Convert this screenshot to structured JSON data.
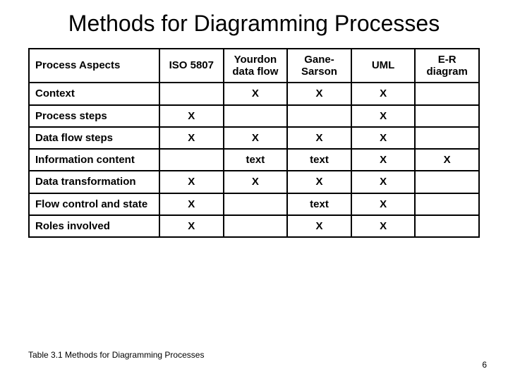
{
  "title": "Methods for Diagramming Processes",
  "table": {
    "corner": "Process Aspects",
    "cols": [
      "ISO 5807",
      "Yourdon data flow",
      "Gane-Sarson",
      "UML",
      "E-R diagram"
    ],
    "rows": [
      {
        "label": "Context",
        "cells": [
          "",
          "X",
          "X",
          "X",
          ""
        ]
      },
      {
        "label": "Process steps",
        "cells": [
          "X",
          "",
          "",
          "X",
          ""
        ]
      },
      {
        "label": "Data flow steps",
        "cells": [
          "X",
          "X",
          "X",
          "X",
          ""
        ]
      },
      {
        "label": "Information content",
        "cells": [
          "",
          "text",
          "text",
          "X",
          "X"
        ]
      },
      {
        "label": "Data transformation",
        "cells": [
          "X",
          "X",
          "X",
          "X",
          ""
        ]
      },
      {
        "label": "Flow control and state",
        "cells": [
          "X",
          "",
          "text",
          "X",
          ""
        ]
      },
      {
        "label": "Roles involved",
        "cells": [
          "X",
          "",
          "X",
          "X",
          ""
        ]
      }
    ]
  },
  "caption": "Table 3.1  Methods for Diagramming Processes",
  "page": "6",
  "chart_data": {
    "type": "table",
    "title": "Methods for Diagramming Processes",
    "columns": [
      "Process Aspects",
      "ISO 5807",
      "Yourdon data flow",
      "Gane-Sarson",
      "UML",
      "E-R diagram"
    ],
    "rows": [
      [
        "Context",
        "",
        "X",
        "X",
        "X",
        ""
      ],
      [
        "Process steps",
        "X",
        "",
        "",
        "X",
        ""
      ],
      [
        "Data flow steps",
        "X",
        "X",
        "X",
        "X",
        ""
      ],
      [
        "Information content",
        "",
        "text",
        "text",
        "X",
        "X"
      ],
      [
        "Data transformation",
        "X",
        "X",
        "X",
        "X",
        ""
      ],
      [
        "Flow control and state",
        "X",
        "",
        "text",
        "X",
        ""
      ],
      [
        "Roles involved",
        "X",
        "",
        "X",
        "X",
        ""
      ]
    ]
  }
}
